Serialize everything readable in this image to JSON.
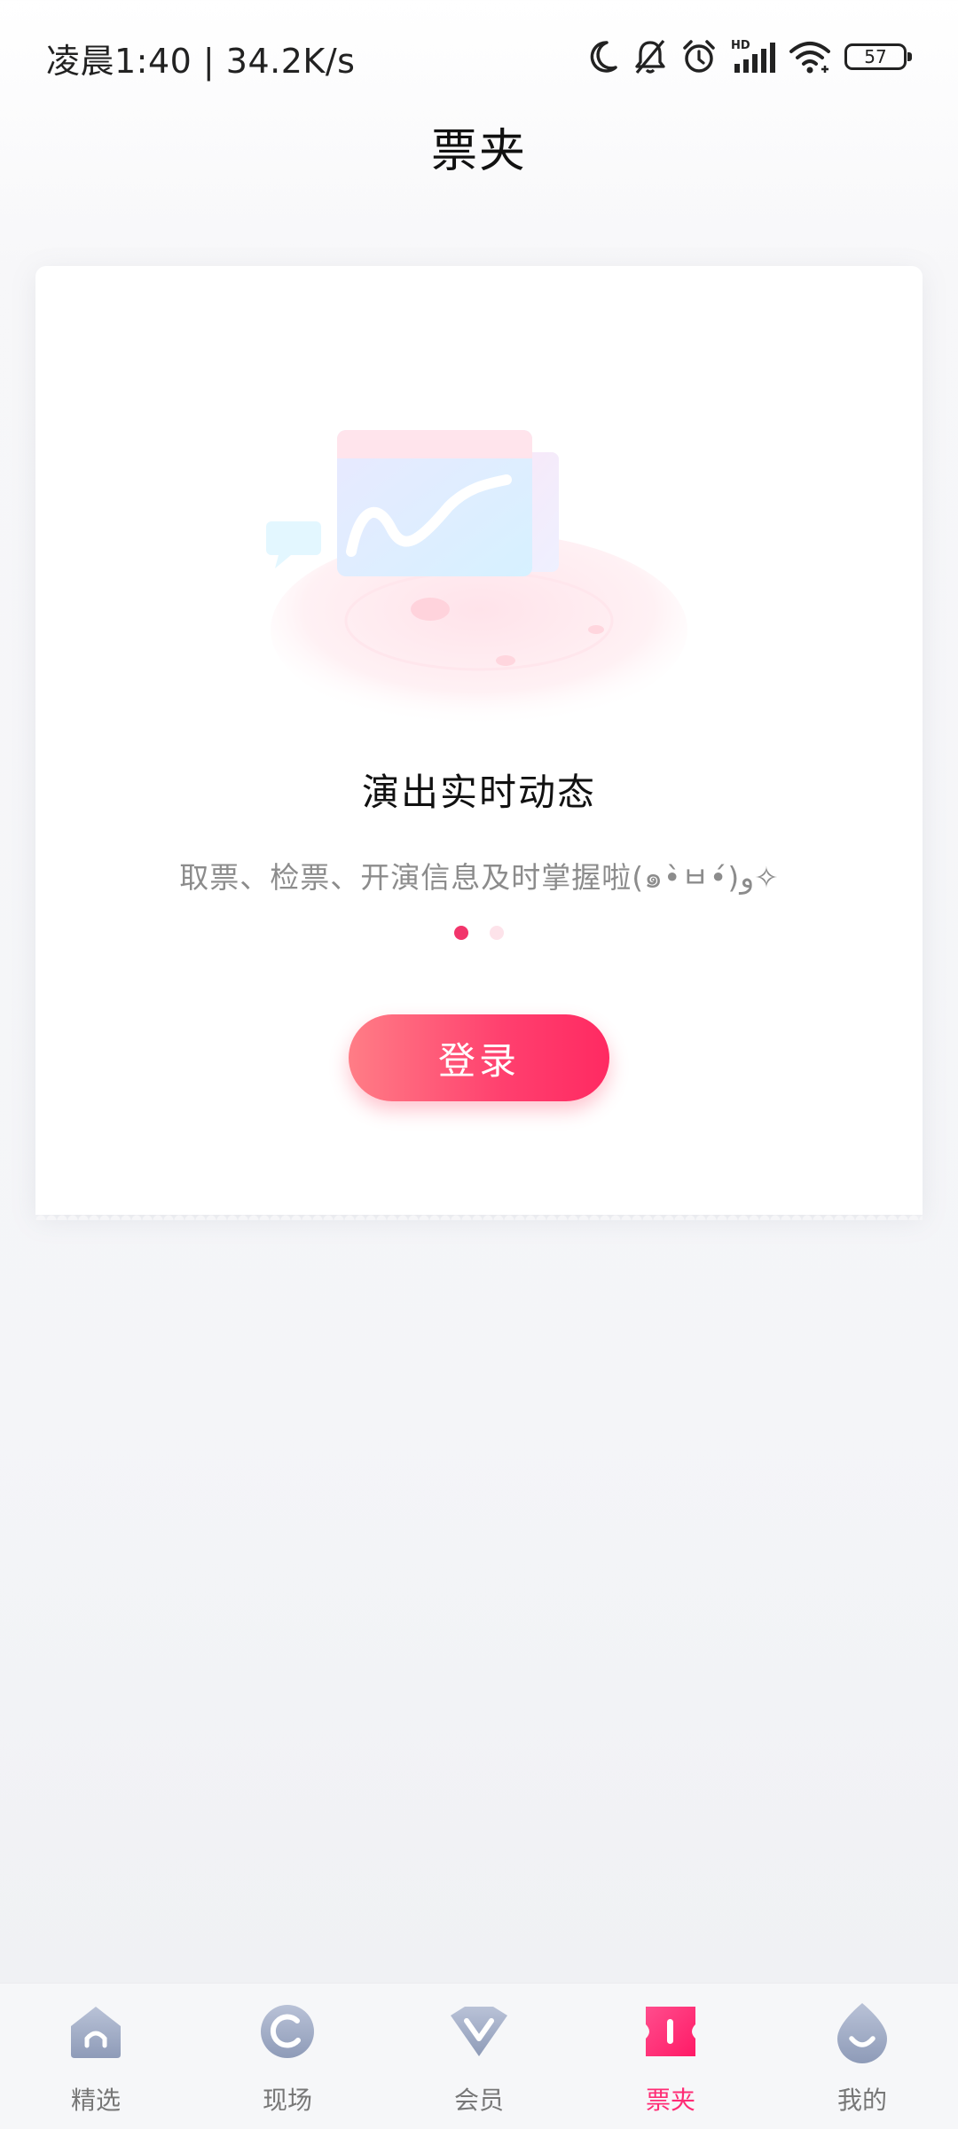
{
  "status_bar": {
    "time_speed": "凌晨1:40 | 34.2K/s",
    "icons": [
      "moon-icon",
      "bell-off-icon",
      "alarm-icon",
      "signal-hd-icon",
      "wifi-icon",
      "battery-icon"
    ],
    "hd_label": "HD",
    "battery": "57"
  },
  "header": {
    "title": "票夹"
  },
  "card": {
    "slides": [
      {
        "title": "演出实时动态",
        "subtitle": "取票、检票、开演信息及时掌握啦(๑•̀ㅂ•́)و✧"
      }
    ],
    "pager": {
      "current": 1,
      "total": 2
    },
    "login_label": "登录"
  },
  "tab_bar": {
    "active": "票夹",
    "tabs": [
      {
        "label": "精选",
        "icon": "home-icon"
      },
      {
        "label": "现场",
        "icon": "live-icon"
      },
      {
        "label": "会员",
        "icon": "vip-icon"
      },
      {
        "label": "票夹",
        "icon": "ticket-icon"
      },
      {
        "label": "我的",
        "icon": "profile-icon"
      }
    ]
  },
  "colors": {
    "accent": "#ff2c75",
    "button_gradient_start": "#ff7d86",
    "button_gradient_end": "#ff2a62",
    "dot_active": "#f2356b",
    "dot_inactive": "#fde3ea",
    "tab_icon_inactive": "#a7b1c8"
  }
}
